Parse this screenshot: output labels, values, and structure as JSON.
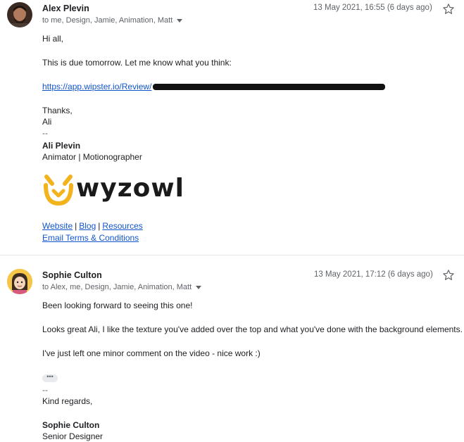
{
  "messages": [
    {
      "sender": "Alex Plevin",
      "recipients": "to me, Design, Jamie, Animation, Matt",
      "date": "13 May 2021, 16:55 (6 days ago)",
      "body": {
        "greeting": "Hi all,",
        "line1": "This is due tomorrow. Let me know what you think:",
        "link": "https://app.wipster.io/Review/",
        "signoff": "Thanks,",
        "name_short": "Ali",
        "dash": "--",
        "signature_name": "Ali Plevin",
        "signature_title": "Animator | Motionographer",
        "logo_text": "wyzowl",
        "links_row1": [
          "Website",
          "Blog",
          "Resources"
        ],
        "link_separator": "|",
        "links_row2": "Email Terms & Conditions"
      },
      "colors": {
        "logo_accent": "#f2b31d"
      }
    },
    {
      "sender": "Sophie Culton",
      "recipients": "to Alex, me, Design, Jamie, Animation, Matt",
      "date": "13 May 2021, 17:12 (6 days ago)",
      "body": {
        "line1": "Been looking forward to seeing this one!",
        "line2": "Looks great Ali, I like the texture you've added over the top and what you've done with the background elements.",
        "line3": "I've just left one minor comment on the video - nice work :)",
        "ellipsis": "•••",
        "dash": "--",
        "signoff": "Kind regards,",
        "signature_name": "Sophie Culton",
        "signature_title": "Senior Designer"
      }
    }
  ],
  "icons": {
    "star": "star-outline-icon",
    "caret": "chevron-down-icon"
  },
  "colors": {
    "link": "#1155cc",
    "meta": "#5f6368",
    "text": "#202124"
  }
}
